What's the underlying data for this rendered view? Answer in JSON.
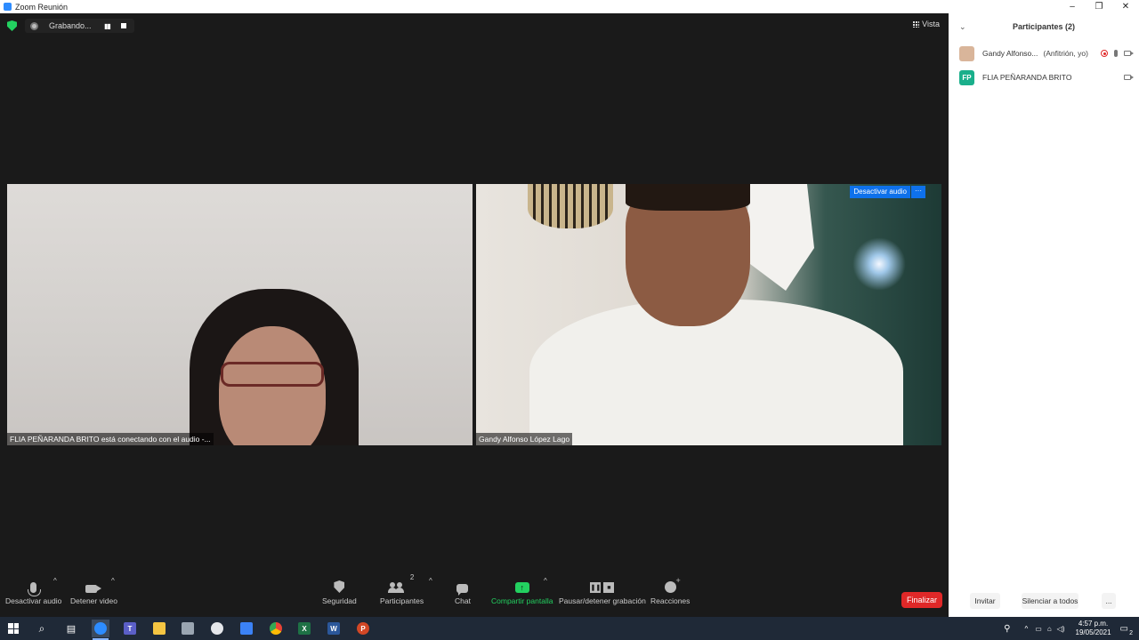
{
  "window": {
    "title": "Zoom Reunión",
    "controls": [
      "–",
      "❐",
      "✕"
    ]
  },
  "recording": {
    "status_text": "Grabando...",
    "pause_glyph": "▮▮"
  },
  "view": {
    "label": "Vista"
  },
  "tiles": [
    {
      "name": "FLIA PEÑARANDA BRITO está conectando con el audio -..."
    },
    {
      "name": "Gandy Alfonso López Lago",
      "banner_button": "Desactivar audio",
      "banner_more": "···"
    }
  ],
  "toolbar": {
    "mute": "Desactivar audio",
    "video": "Detener video",
    "security": "Seguridad",
    "participants": "Participantes",
    "participants_count": "2",
    "chat": "Chat",
    "share": "Compartir pantalla",
    "recording": "Pausar/detener grabación",
    "reactions": "Reacciones",
    "end": "Finalizar",
    "caret": "^"
  },
  "panel": {
    "title": "Participantes (2)",
    "collapse_glyph": "⌄",
    "participants": [
      {
        "name": "Gandy Alfonso...",
        "role": "(Anfitrión, yo)",
        "avatar_color": "#d9b59a"
      },
      {
        "name": "FLIA PEÑARANDA BRITO",
        "initials": "FP",
        "avatar_color": "#1aaf8b"
      }
    ],
    "footer": {
      "invite": "Invitar",
      "mute_all": "Silenciar a todos",
      "more": "..."
    }
  },
  "taskbar": {
    "time": "4:57 p.m.",
    "date": "19/05/2021",
    "notifications": "2",
    "apps": [
      {
        "name": "zoom",
        "color": "#2d8cff",
        "letter": ""
      },
      {
        "name": "teams",
        "color": "#5b5fc7",
        "letter": "T"
      },
      {
        "name": "explorer",
        "color": "#f5c542",
        "letter": ""
      },
      {
        "name": "app",
        "color": "#9aa5b1",
        "letter": ""
      },
      {
        "name": "app2",
        "color": "#e5e7eb",
        "letter": ""
      },
      {
        "name": "photos",
        "color": "#3b82f6",
        "letter": ""
      },
      {
        "name": "chrome",
        "color": "#34a853",
        "letter": ""
      },
      {
        "name": "excel",
        "color": "#1e7145",
        "letter": "X"
      },
      {
        "name": "word",
        "color": "#2b579a",
        "letter": "W"
      },
      {
        "name": "powerpoint",
        "color": "#d24726",
        "letter": "P"
      }
    ]
  }
}
